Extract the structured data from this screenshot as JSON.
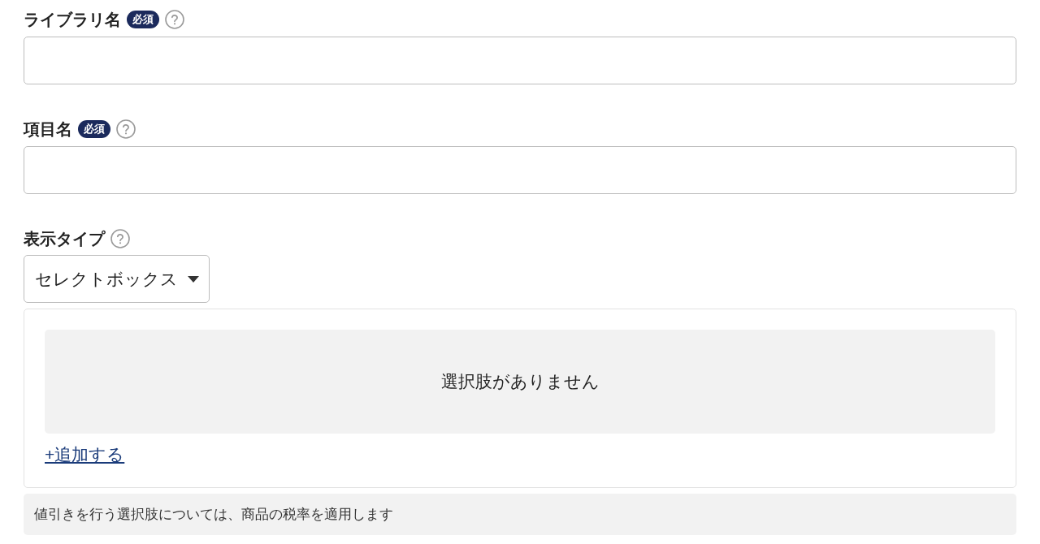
{
  "form_fields": [
    {
      "kind": "text_input",
      "label": "ライブラリ名",
      "required_badge": "必須"
    },
    {
      "kind": "text_input",
      "label": "項目名",
      "required_badge": "必須"
    },
    {
      "kind": "select",
      "label": "表示タイプ",
      "value": "セレクトボックス"
    }
  ],
  "options_panel": {
    "empty_message": "選択肢がありません",
    "add_link": "+追加する"
  },
  "note": "値引きを行う選択肢については、商品の税率を適用します"
}
